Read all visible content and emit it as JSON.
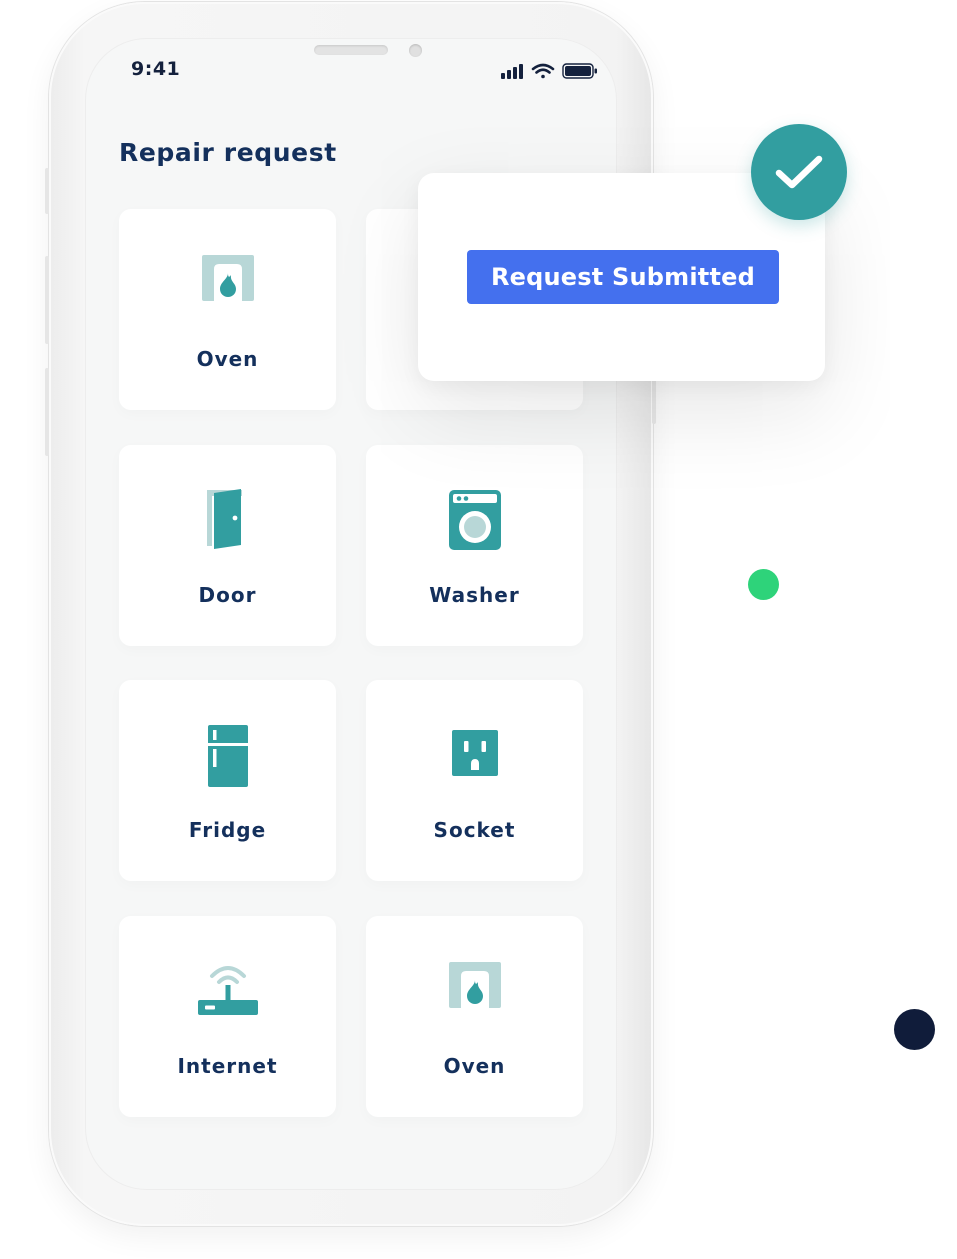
{
  "status_bar": {
    "time": "9:41"
  },
  "page": {
    "title": "Repair request"
  },
  "tiles": [
    {
      "label": "Oven",
      "icon": "oven-icon"
    },
    {
      "label": "",
      "icon": ""
    },
    {
      "label": "Door",
      "icon": "door-icon"
    },
    {
      "label": "Washer",
      "icon": "washer-icon"
    },
    {
      "label": "Fridge",
      "icon": "fridge-icon"
    },
    {
      "label": "Socket",
      "icon": "socket-icon"
    },
    {
      "label": "Internet",
      "icon": "router-icon"
    },
    {
      "label": "Oven",
      "icon": "oven-icon"
    }
  ],
  "popup": {
    "button_label": "Request Submitted"
  },
  "colors": {
    "accent_teal": "#329ea0",
    "button_blue": "#4470ee",
    "text_navy": "#14305c",
    "dot_green": "#2ed37a",
    "dot_navy": "#101c3a"
  }
}
